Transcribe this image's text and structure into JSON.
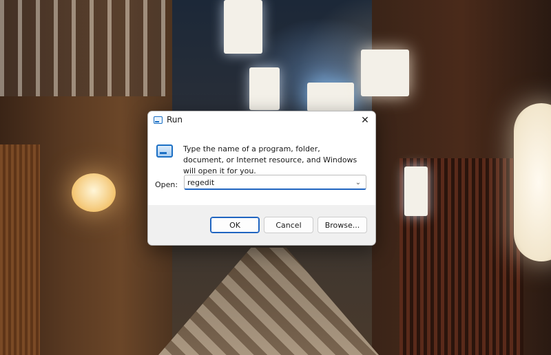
{
  "dialog": {
    "title": "Run",
    "close_glyph": "✕",
    "description": "Type the name of a program, folder, document, or Internet resource, and Windows will open it for you.",
    "open_label": "Open:",
    "open_value": "regedit",
    "dropdown_glyph": "⌄",
    "buttons": {
      "ok": "OK",
      "cancel": "Cancel",
      "browse": "Browse..."
    },
    "icons": {
      "title": "run-icon",
      "content": "run-program-icon",
      "close": "close-icon",
      "dropdown": "chevron-down-icon"
    },
    "colors": {
      "accent": "#1f64c0",
      "icon_blue": "#1b6fc4"
    }
  }
}
